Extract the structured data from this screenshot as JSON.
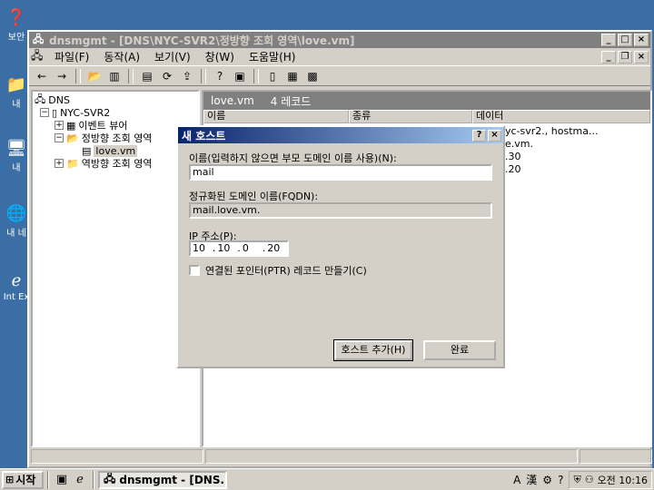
{
  "window": {
    "title": "dnsmgmt - [DNS\\NYC-SVR2\\정방향 조회 영역\\love.vm]",
    "menus": [
      "파일(F)",
      "동작(A)",
      "보기(V)",
      "창(W)",
      "도움말(H)"
    ]
  },
  "tree": {
    "items": [
      {
        "label": "DNS",
        "icon": "dns-icon"
      },
      {
        "label": "NYC-SVR2",
        "icon": "server-icon"
      },
      {
        "label": "이벤트 뷰어",
        "icon": "event-viewer-icon"
      },
      {
        "label": "정방향 조회 영역",
        "icon": "folder-icon"
      },
      {
        "label": "love.vm",
        "icon": "zone-icon"
      },
      {
        "label": "역방향 조회 영역",
        "icon": "folder-icon"
      }
    ]
  },
  "right_pane": {
    "header_title": "love.vm",
    "record_count": "4 레코드",
    "columns": [
      "이름",
      "종류",
      "데이터"
    ],
    "visible_data": [
      "yc-svr2., hostma...",
      "e.vm.",
      ".30",
      ".20"
    ]
  },
  "dialog": {
    "title": "새 호스트",
    "name_label": "이름(입력하지 않으면 부모 도메인 이름 사용)(N):",
    "name_value": "mail",
    "fqdn_label": "정규화된 도메인 이름(FQDN):",
    "fqdn_value": "mail.love.vm.",
    "ip_label": "IP 주소(P):",
    "ip_octets": [
      "10",
      "10",
      "0",
      "20"
    ],
    "ip_dot": ".",
    "ptr_label": "연결된 포인터(PTR) 레코드 만들기(C)",
    "ptr_checked": false,
    "add_button": "호스트 추가(H)",
    "done_button": "완료",
    "help_btn": "?",
    "close_btn": "×"
  },
  "desktop_icons": [
    "보안",
    "내",
    "내",
    "내 네",
    "Int Ex"
  ],
  "taskbar": {
    "start_label": "시작",
    "task_label": "dnsmgmt - [DNS...",
    "ime_a": "A",
    "ime_han": "漢",
    "clock": "오전 10:16"
  }
}
